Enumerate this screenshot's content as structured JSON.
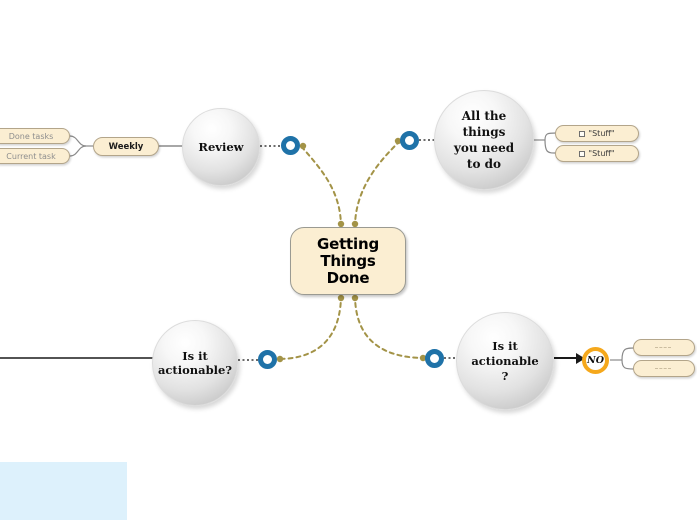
{
  "diagram": {
    "title": "Getting Things Done",
    "type": "mind-map",
    "colors": {
      "node_fill": "#fbeed2",
      "node_border": "#b3a58a",
      "connector": "#a39347",
      "ring_blue": "#1f72a8",
      "ring_amber": "#f5a81c",
      "panel_blue": "#ddf1fc",
      "canvas": "#ffffff"
    }
  },
  "center": {
    "label": "Getting\nThings\nDone"
  },
  "nodes": {
    "review": {
      "label": "Review"
    },
    "all_things": {
      "label": "All the\nthings\nyou need\nto do"
    },
    "actionable_left": {
      "label": "Is it\nactionable?"
    },
    "actionable_right": {
      "label": "Is it\nactionable\n?"
    }
  },
  "pills": {
    "done_tasks": {
      "label": "Done tasks"
    },
    "current_task": {
      "label": "Current task"
    },
    "weekly": {
      "label": "Weekly"
    },
    "stuff_1": {
      "label": "\"Stuff\""
    },
    "stuff_2": {
      "label": "\"Stuff\""
    },
    "blank_1": {
      "label": ""
    },
    "blank_2": {
      "label": ""
    }
  },
  "rings": {
    "top_left": {
      "label": "",
      "color": "#1f72a8"
    },
    "top_right": {
      "label": "",
      "color": "#1f72a8"
    },
    "bottom_left": {
      "label": "",
      "color": "#1f72a8"
    },
    "bottom_right": {
      "label": "",
      "color": "#1f72a8"
    },
    "no": {
      "label": "NO",
      "color": "#f5a81c"
    }
  }
}
